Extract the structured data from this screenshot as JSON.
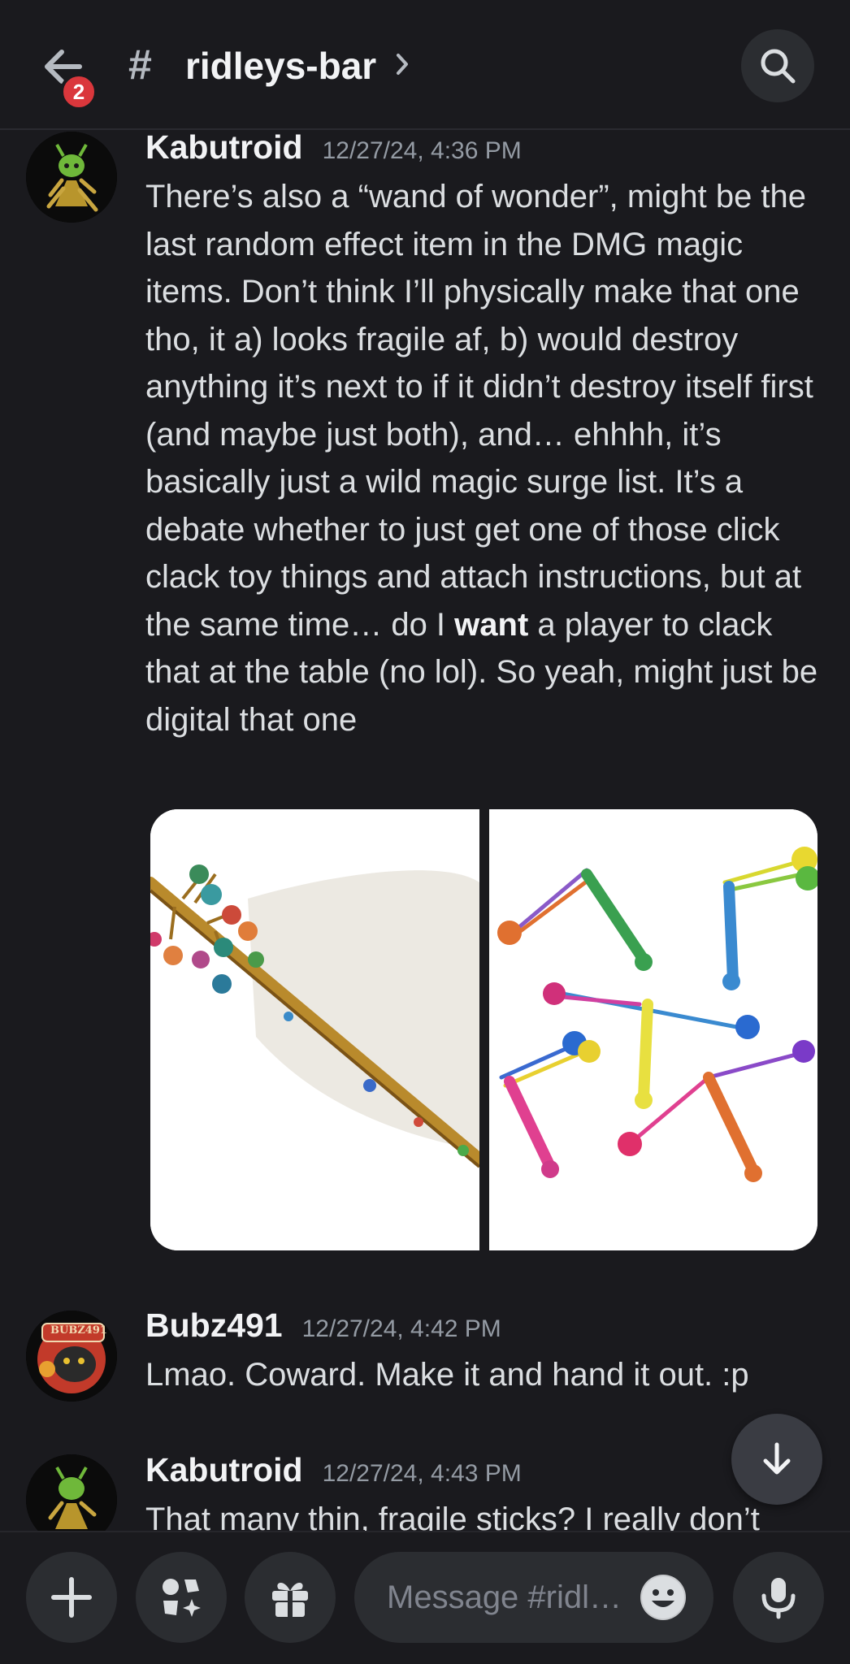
{
  "header": {
    "back_badge": "2",
    "hash_symbol": "#",
    "channel_name": "ridleys-bar"
  },
  "messages": [
    {
      "username": "Kabutroid",
      "timestamp": "12/27/24, 4:36 PM",
      "text_before_bold": "There’s also a “wand of wonder”, might be the last random effect item in the DMG magic items. Don’t think I’ll physically make that one tho, it a) looks fragile af, b) would destroy anything it’s next to if it didn’t destroy itself first (and maybe just both), and… ehhhh, it’s basically just a wild magic surge list. It’s a debate whether to just get one of those click clack toy things and attach instructions, but at the same time… do I ",
      "bold": "want",
      "text_after_bold": " a player to clack that at the table (no lol). So yeah, might just be digital that one"
    },
    {
      "username": "Bubz491",
      "avatar_text": "BUBZ491",
      "timestamp": "12/27/24, 4:42 PM",
      "text": "Lmao. Coward. Make it and hand it out. :p"
    },
    {
      "username": "Kabutroid",
      "timestamp": "12/27/24, 4:43 PM",
      "text": "That many thin, fragile sticks? I really don’t"
    }
  ],
  "composer": {
    "placeholder": "Message #ridl…"
  },
  "icons": [
    "back-arrow-icon",
    "search-icon",
    "chevron-right-icon",
    "arrow-down-icon",
    "plus-icon",
    "apps-icon",
    "gift-icon",
    "emoji-icon",
    "microphone-icon"
  ],
  "colors": {
    "background": "#1a1a1e",
    "badge": "#da373c",
    "button": "#2b2d31"
  }
}
